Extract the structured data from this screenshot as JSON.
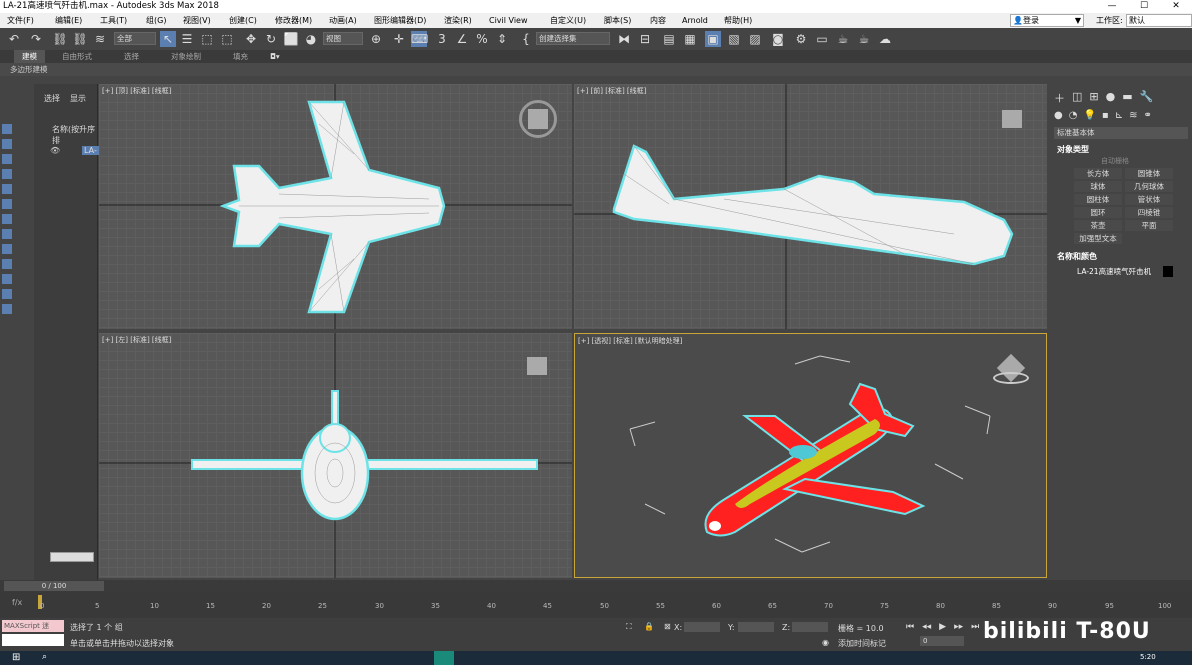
{
  "window": {
    "title": "LA-21高速喷气歼击机.max - Autodesk 3ds Max 2018",
    "min": "—",
    "max": "☐",
    "close": "✕"
  },
  "menu": {
    "items": [
      "文件(F)",
      "编辑(E)",
      "工具(T)",
      "组(G)",
      "视图(V)",
      "创建(C)",
      "修改器(M)",
      "动画(A)",
      "图形编辑器(D)",
      "渲染(R)",
      "Civil View",
      "自定义(U)",
      "脚本(S)",
      "内容",
      "Arnold",
      "帮助(H)"
    ],
    "login": "登录",
    "workspace_label": "工作区:",
    "workspace_value": "默认"
  },
  "toolbar": {
    "filter": "全部",
    "refcoord": "视图",
    "selset": "创建选择集"
  },
  "ribbon": {
    "tabs": [
      "建模",
      "自由形式",
      "选择",
      "对象绘制",
      "填充"
    ],
    "sub": "多边形建模"
  },
  "scene": {
    "tab_select": "选择",
    "tab_display": "显示",
    "col_header": "名称(按升序排",
    "obj": "LA-"
  },
  "viewports": [
    {
      "label": "[+] [顶] [标准] [线框]"
    },
    {
      "label": "[+] [前] [标准] [线框]"
    },
    {
      "label": "[+] [左] [标准] [线框]"
    },
    {
      "label": "[+] [透视] [标准] [默认明暗处理]"
    }
  ],
  "cmd": {
    "category": "标准基本体",
    "rollout_objtype": "对象类型",
    "autogrid": "自动栅格",
    "buttons": [
      "长方体",
      "圆锥体",
      "球体",
      "几何球体",
      "圆柱体",
      "管状体",
      "圆环",
      "四棱锥",
      "茶壶",
      "平面",
      "加强型文本"
    ],
    "rollout_name": "名称和颜色",
    "obj_name": "LA-21高速喷气歼击机",
    "obj_color": "#000000"
  },
  "timeslider": {
    "frame": "0 / 100"
  },
  "timeline": {
    "ticks": [
      "0",
      "5",
      "10",
      "15",
      "20",
      "25",
      "30",
      "35",
      "40",
      "45",
      "50",
      "55",
      "60",
      "65",
      "70",
      "75",
      "80",
      "85",
      "90",
      "95",
      "100"
    ]
  },
  "status": {
    "maxscript": "MAXScript 迷",
    "line1": "选择了 1 个 组",
    "line2": "单击或单击并拖动以选择对象",
    "x_label": "X:",
    "y_label": "Y:",
    "z_label": "Z:",
    "grid": "栅格 = 10.0",
    "addtime": "添加时间标记",
    "frame_val": "0",
    "watermark": "bilibili T-80U"
  },
  "taskbar": {
    "clock": "5:20"
  },
  "colors": {
    "accent": "#c8a63a",
    "plane_red": "#ff2020",
    "plane_yellow": "#c8c81e",
    "selection_cyan": "#5de0e6"
  }
}
